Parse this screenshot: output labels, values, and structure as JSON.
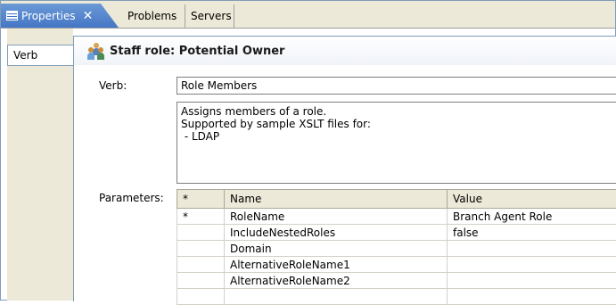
{
  "tabs": {
    "properties": "Properties",
    "problems": "Problems",
    "servers": "Servers",
    "close": "✕"
  },
  "sidebar": {
    "verb_tab": "Verb"
  },
  "header": {
    "title": "Staff role: Potential Owner",
    "icon": "people-icon"
  },
  "form": {
    "verb_label": "Verb:",
    "verb_value": "Role Members",
    "description": "Assigns members of a role.\nSupported by sample XSLT files for:\n - LDAP",
    "parameters_label": "Parameters:"
  },
  "parameters_table": {
    "headers": [
      "*",
      "Name",
      "Value"
    ],
    "rows": [
      {
        "req": "*",
        "name": "RoleName",
        "value": "Branch Agent Role"
      },
      {
        "req": "",
        "name": "IncludeNestedRoles",
        "value": "false"
      },
      {
        "req": "",
        "name": "Domain",
        "value": ""
      },
      {
        "req": "",
        "name": "AlternativeRoleName1",
        "value": ""
      },
      {
        "req": "",
        "name": "AlternativeRoleName2",
        "value": ""
      },
      {
        "req": "",
        "name": "",
        "value": ""
      }
    ]
  },
  "colors": {
    "active_tab": "#4576c5",
    "chrome": "#ece9d8",
    "border": "#7f9db9"
  }
}
